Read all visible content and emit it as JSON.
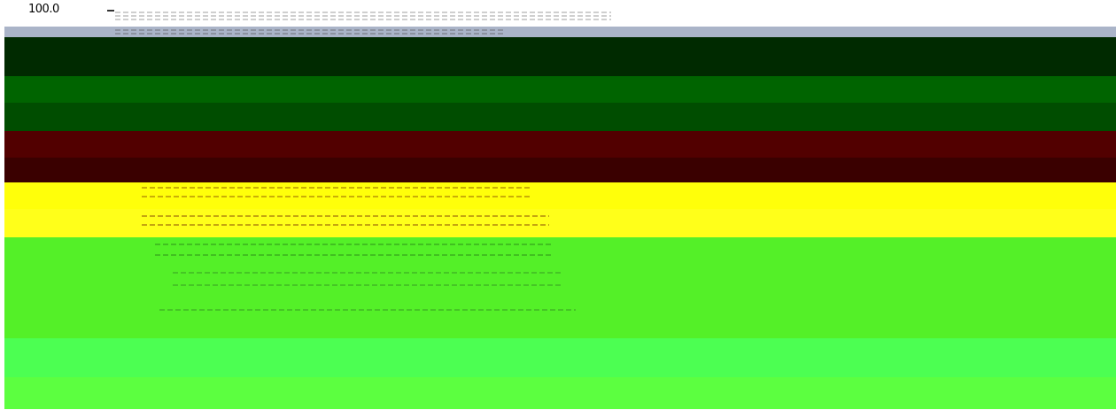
{
  "scale": {
    "label": "100.0"
  },
  "chart_data": {
    "type": "heatmap",
    "title": "",
    "xlabel": "",
    "ylabel": "",
    "bands": [
      {
        "color": "#aab4c8"
      },
      {
        "color": "#002a00"
      },
      {
        "color": "#006400"
      },
      {
        "color": "#004d00"
      },
      {
        "color": "#520000"
      },
      {
        "color": "#3a0000"
      },
      {
        "color": "#ffff0a"
      },
      {
        "color": "#ffff1a"
      },
      {
        "color": "#54f028"
      },
      {
        "color": "#4cff52"
      },
      {
        "color": "#5cff40"
      }
    ]
  }
}
